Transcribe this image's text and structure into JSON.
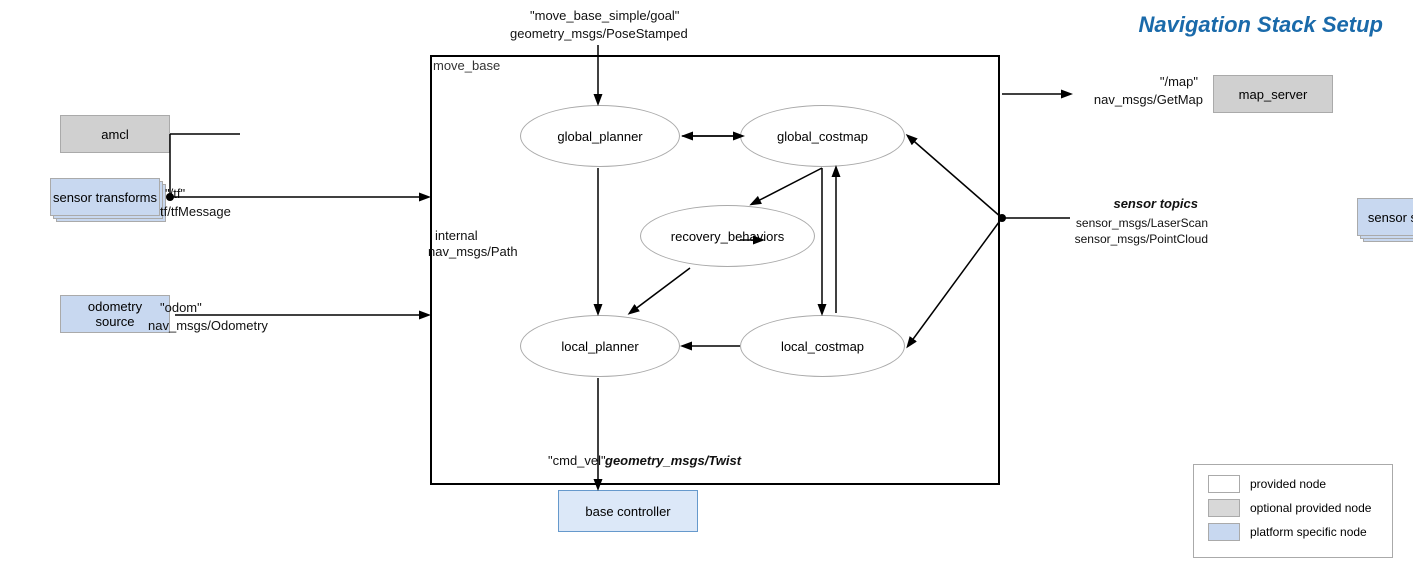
{
  "title": "Navigation Stack Setup",
  "move_base_label": "move_base",
  "nodes": {
    "amcl": "amcl",
    "sensor_transforms": "sensor transforms",
    "odometry_source": "odometry source",
    "map_server": "map_server",
    "sensor_sources": "sensor sources",
    "base_controller": "base controller",
    "global_planner": "global_planner",
    "global_costmap": "global_costmap",
    "local_planner": "local_planner",
    "local_costmap": "local_costmap",
    "recovery_behaviors": "recovery_behaviors"
  },
  "labels": {
    "goal_topic": "\"move_base_simple/goal\"",
    "goal_msg": "geometry_msgs/PoseStamped",
    "tf_topic": "\"/tf\"",
    "tf_msg": "tf/tfMessage",
    "odom_topic": "\"odom\"",
    "odom_msg": "nav_msgs/Odometry",
    "map_topic": "\"/map\"",
    "map_msg": "nav_msgs/GetMap",
    "sensor_topics_label": "sensor topics",
    "sensor_msgs1": "sensor_msgs/LaserScan",
    "sensor_msgs2": "sensor_msgs/PointCloud",
    "internal_label": "internal",
    "internal_msg": "nav_msgs/Path",
    "cmd_vel_topic": "\"cmd_vel\"",
    "cmd_vel_msg": "geometry_msgs/Twist"
  },
  "legend": {
    "items": [
      {
        "label": "provided node",
        "color": "white"
      },
      {
        "label": "optional provided node",
        "color": "lgray"
      },
      {
        "label": "platform specific node",
        "color": "blue"
      }
    ]
  }
}
